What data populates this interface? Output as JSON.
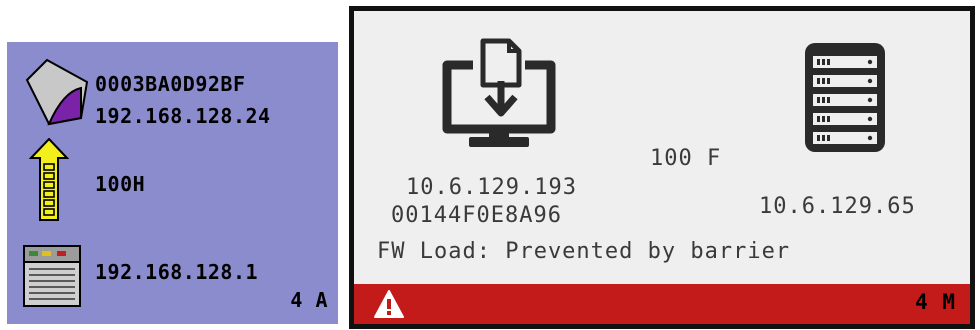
{
  "left_panel": {
    "device_id": "0003BA0D92BF",
    "device_ip": "192.168.128.24",
    "link_speed": "100H",
    "gateway_ip": "192.168.128.1",
    "status_code": "4 A",
    "background_color": "#8b8ccd",
    "icons": [
      "device-icon",
      "arrow-up-icon",
      "server-icon"
    ]
  },
  "right_panel": {
    "link_speed": "100 F",
    "client_ip": "10.6.129.193",
    "client_mac": "00144F0E8A96",
    "server_ip": "10.6.129.65",
    "status_message": "FW Load: Prevented by barrier",
    "status_code": "4 M",
    "alert_color": "#c31a1a",
    "icons": [
      "client-download-icon",
      "server-rack-icon",
      "warning-icon"
    ]
  }
}
